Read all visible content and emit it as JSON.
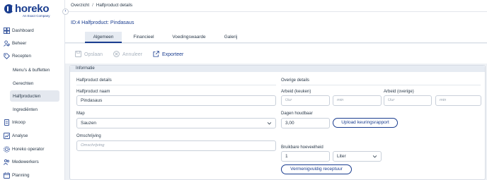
{
  "brand": {
    "name": "horeko",
    "tagline": "An Exact Company"
  },
  "breadcrumb": {
    "items": [
      "Overzicht",
      "Halfproduct details"
    ],
    "separator": "/"
  },
  "page_title": "ID:4  Halfproduct: Pindasaus",
  "sidebar": {
    "items": [
      {
        "label": "Dashboard",
        "icon": "dashboard-icon"
      },
      {
        "label": "Beheer",
        "icon": "users-gear-icon"
      },
      {
        "label": "Recepten",
        "icon": "recipe-tag-icon"
      },
      {
        "label": "Menu's & buffetten",
        "sub": true
      },
      {
        "label": "Gerechten",
        "sub": true
      },
      {
        "label": "Halfproducten",
        "sub": true,
        "active": true
      },
      {
        "label": "Ingrediënten",
        "sub": true
      },
      {
        "label": "Inkoop",
        "icon": "purchase-document-icon"
      },
      {
        "label": "Analyse",
        "icon": "chart-icon"
      },
      {
        "label": "Horeko operator",
        "icon": "operator-gear-icon"
      },
      {
        "label": "Medewerkers",
        "icon": "employees-icon"
      },
      {
        "label": "Planning",
        "icon": "calendar-icon"
      }
    ]
  },
  "tabs": [
    {
      "label": "Algemeen",
      "active": true
    },
    {
      "label": "Financieel"
    },
    {
      "label": "Voedingswaarde"
    },
    {
      "label": "Galerij"
    }
  ],
  "toolbar": {
    "save_label": "Opslaan",
    "cancel_label": "Annuleer",
    "export_label": "Exporteer"
  },
  "panel": {
    "header": "Informatie",
    "left_section": "Halfproduct details",
    "right_section": "Overige details",
    "name_label": "Halfproduct naam",
    "name_value": "Pindasaus",
    "map_label": "Map",
    "map_value": "Sauzen",
    "description_label": "Omschrijving",
    "description_placeholder": "Omschrijving",
    "work_kitchen_label": "Arbeid (keuken)",
    "work_other_label": "Arbeid (overige)",
    "hours_placeholder": "Uur",
    "minutes_placeholder": "min",
    "shelf_life_label": "Dagen houdbaar",
    "shelf_life_value": "3,00",
    "upload_button": "Upload keuringsrapport",
    "usable_amount_label": "Bruikbare hoeveelheid",
    "usable_amount_value": "1",
    "unit_value": "Liter",
    "multiply_button": "Vermenigvuldig receptuur"
  },
  "colors": {
    "brand": "#1a3d8f",
    "active_bg": "#e4e8ef",
    "disabled": "#a9b3bf"
  }
}
